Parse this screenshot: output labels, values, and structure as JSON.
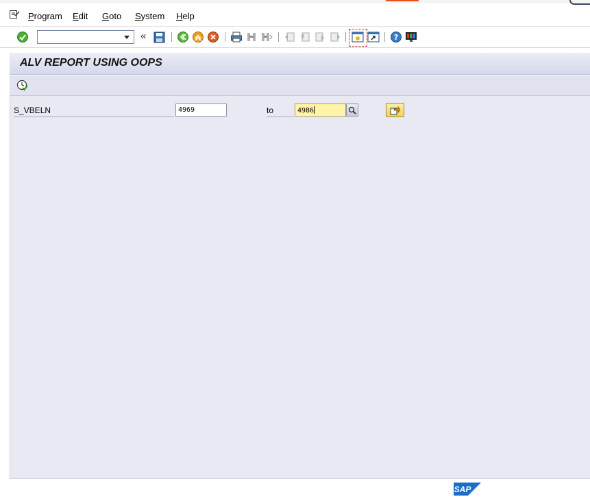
{
  "menu": {
    "items": [
      {
        "label": "Program"
      },
      {
        "label": "Edit"
      },
      {
        "label": "Goto"
      },
      {
        "label": "System"
      },
      {
        "label": "Help"
      }
    ]
  },
  "toolbar": {
    "command_field_value": "",
    "icons": [
      "enter-icon",
      "command-dropdown",
      "collapse-icon",
      "save-icon",
      "back-icon",
      "exit-icon",
      "cancel-icon",
      "print-icon",
      "find-icon",
      "find-next-icon",
      "first-page-icon",
      "previous-page-icon",
      "next-page-icon",
      "last-page-icon",
      "create-session-icon",
      "create-shortcut-icon",
      "help-icon",
      "customize-layout-icon"
    ]
  },
  "screen": {
    "title": "ALV REPORT USING OOPS"
  },
  "app_toolbar": {
    "icons": [
      "execute-icon"
    ]
  },
  "selection": {
    "field_label": "S_VBELN",
    "low_value": "4969",
    "to_label": "to",
    "high_value": "4986"
  },
  "branding": {
    "logo_text": "SAP"
  },
  "colors": {
    "title_bar": "#d6d8ec",
    "content_bg": "#e9e9f4",
    "focused_input": "#fff4a8",
    "sap_blue": "#1a6ec8"
  }
}
